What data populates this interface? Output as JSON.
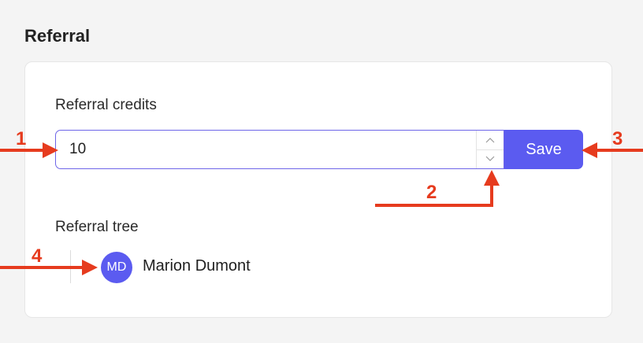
{
  "section": {
    "title": "Referral"
  },
  "credits": {
    "label": "Referral credits",
    "value": "10",
    "save_label": "Save",
    "stepper_up": "^",
    "stepper_down": "v"
  },
  "tree": {
    "label": "Referral tree",
    "user": {
      "initials": "MD",
      "name": "Marion Dumont"
    }
  },
  "annotations": {
    "n1": "1",
    "n2": "2",
    "n3": "3",
    "n4": "4"
  },
  "colors": {
    "accent": "#5b5bf0",
    "annotation": "#e63b1e"
  },
  "icons": {
    "stepper_up": "chevron-up-icon",
    "stepper_down": "chevron-down-icon"
  }
}
